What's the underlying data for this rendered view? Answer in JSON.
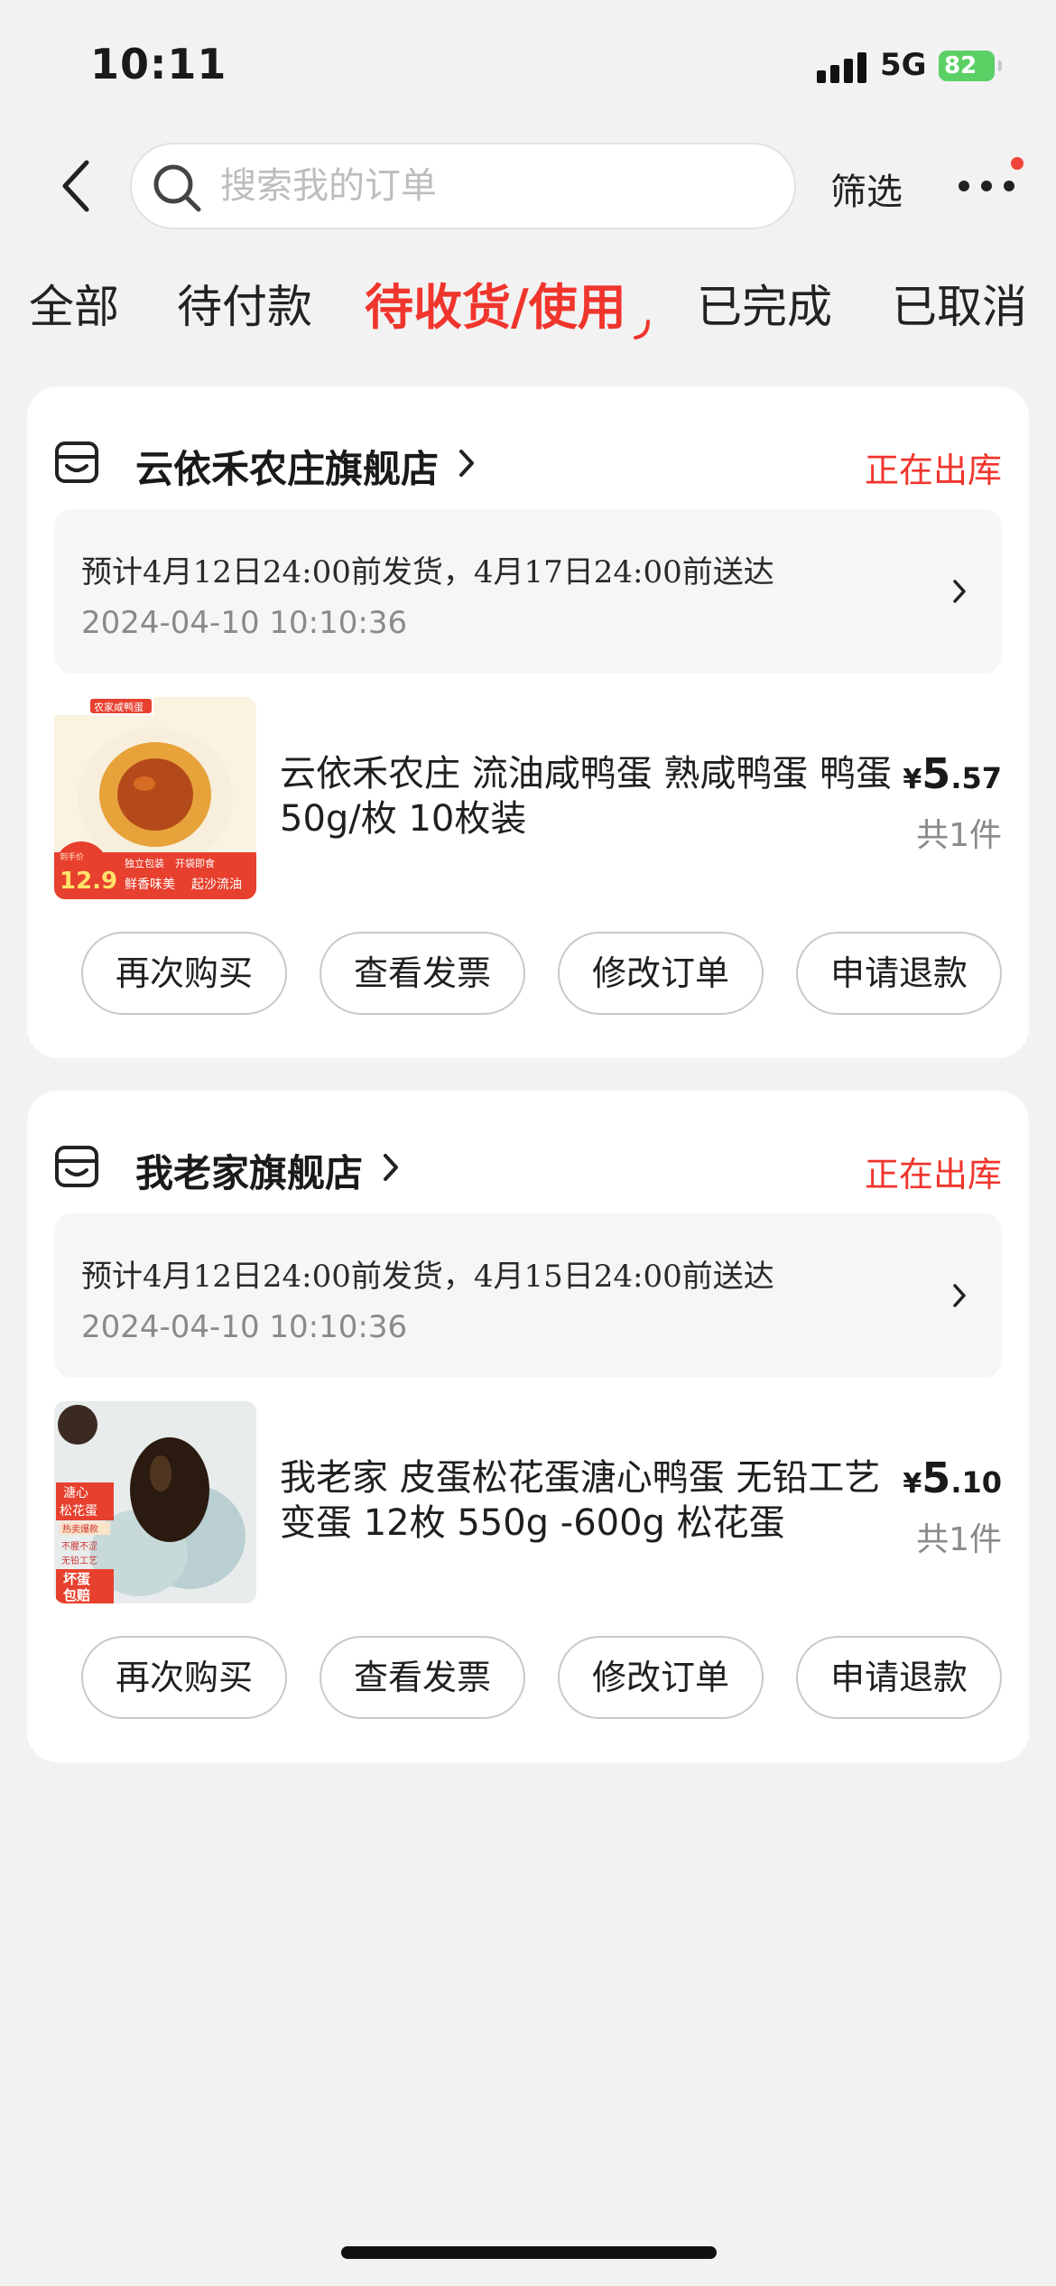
{
  "status_bar": {
    "time": "10:11",
    "network": "5G",
    "battery": "82"
  },
  "header": {
    "search_placeholder": "搜索我的订单",
    "filter_label": "筛选"
  },
  "tabs": [
    {
      "label": "全部"
    },
    {
      "label": "待付款"
    },
    {
      "label": "待收货/使用",
      "active": true
    },
    {
      "label": "已完成"
    },
    {
      "label": "已取消"
    }
  ],
  "orders": [
    {
      "store": "云依禾农庄旗舰店",
      "status": "正在出库",
      "shipping_note": "预计4月12日24:00前发货，4月17日24:00前送达",
      "order_time": "2024-04-10 10:10:36",
      "product_title": "云依禾农庄 流油咸鸭蛋 熟咸鸭蛋 鸭蛋 50g/枚 10枚装",
      "currency": "¥",
      "price_int": "5",
      "price_dec": ".57",
      "quantity": "共1件",
      "thumb_text": {
        "tag": "农家咸鸭蛋",
        "price_label": "到手价",
        "price": "12.9",
        "pack1": "独立包装",
        "pack2": "开袋即食",
        "slogan1": "鲜香味美",
        "slogan2": "起沙流油"
      },
      "buttons": [
        "再次购买",
        "查看发票",
        "修改订单",
        "申请退款"
      ]
    },
    {
      "store": "我老家旗舰店",
      "status": "正在出库",
      "shipping_note": "预计4月12日24:00前发货，4月15日24:00前送达",
      "order_time": "2024-04-10 10:10:36",
      "product_title": "我老家 皮蛋松花蛋溏心鸭蛋 无铅工艺变蛋 12枚 550g -600g 松花蛋",
      "currency": "¥",
      "price_int": "5",
      "price_dec": ".10",
      "quantity": "共1件",
      "thumb_text": {
        "tag1": "溏心",
        "tag2": "松花蛋",
        "hot": "热卖爆款",
        "f1": "不腥不涩",
        "f2": "无铅工艺",
        "guarantee1": "坏蛋",
        "guarantee2": "包赔"
      },
      "buttons": [
        "再次购买",
        "查看发票",
        "修改订单",
        "申请退款"
      ]
    }
  ],
  "colors": {
    "accent": "#f0352d",
    "background": "#f2f2f2",
    "card": "#ffffff",
    "battery": "#5ad065"
  }
}
